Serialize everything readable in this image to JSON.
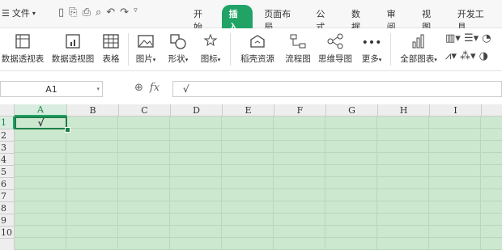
{
  "menubar": {
    "file_label": "文件",
    "tabs": [
      "开始",
      "插入",
      "页面布局",
      "公式",
      "数据",
      "审阅",
      "视图",
      "开发工具"
    ],
    "active_tab": "插入"
  },
  "ribbon": {
    "pivot_table": "数据透视表",
    "pivot_chart": "数据透视图",
    "table": "表格",
    "picture": "图片",
    "shape": "形状",
    "icon": "图标",
    "docer": "稻壳资源",
    "flowchart": "流程图",
    "mindmap": "思维导图",
    "more": "更多",
    "all_charts": "全部图表"
  },
  "formula_bar": {
    "cell_ref": "A1",
    "fx": "fx",
    "content": "√"
  },
  "sheet": {
    "columns": [
      "A",
      "B",
      "C",
      "D",
      "E",
      "F",
      "G",
      "H",
      "I"
    ],
    "rows": [
      "1",
      "2",
      "3",
      "4",
      "5",
      "6",
      "7",
      "8",
      "9",
      "10"
    ],
    "a1_value": "√"
  },
  "colors": {
    "accent": "#21a366",
    "eye_protect_bg": "#cce8cf"
  }
}
